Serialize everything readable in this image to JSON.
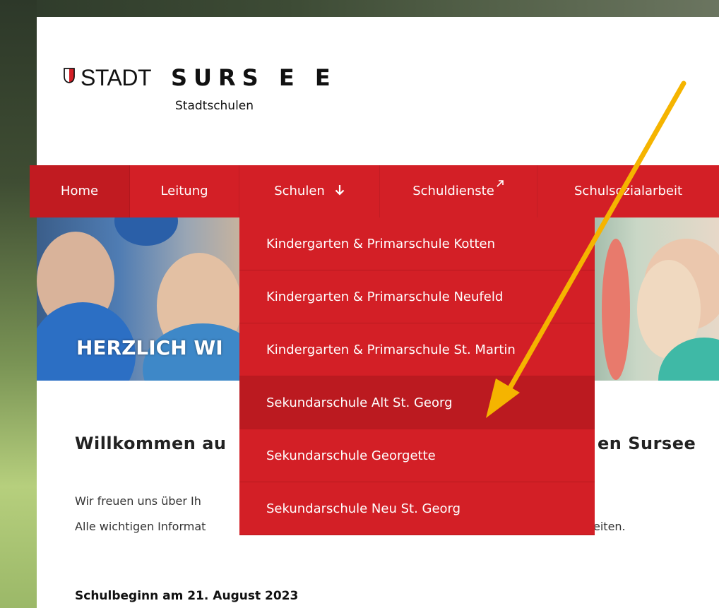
{
  "logo": {
    "stadt": "STADT",
    "sursee": "SURS E E",
    "subtitle": "Stadtschulen",
    "shield_color": "#d31f26"
  },
  "nav": {
    "items": [
      {
        "label": "Home",
        "active": true
      },
      {
        "label": "Leitung"
      },
      {
        "label": "Schulen",
        "icon": "arrow-down-icon",
        "open": true
      },
      {
        "label": "Schuldienste",
        "icon": "external-link-icon"
      },
      {
        "label": "Schulsozialarbeit"
      }
    ],
    "color": "#d31f26"
  },
  "hero": {
    "title": "HERZLICH WI"
  },
  "dropdown": {
    "items": [
      "Kindergarten & Primarschule Kotten",
      "Kindergarten & Primarschule Neufeld",
      "Kindergarten & Primarschule St. Martin",
      "Sekundarschule Alt St. Georg",
      "Sekundarschule Georgette",
      "Sekundarschule Neu St. Georg"
    ],
    "highlighted_index": 3
  },
  "content": {
    "welcome_start": "Willkommen au",
    "welcome_end": "en Sursee",
    "paragraph1": "Wir freuen uns über Ih",
    "paragraph2_start": "Alle wichtigen Informat",
    "paragraph2_end": "eiten.",
    "schulbeginn": "Schulbeginn am 21. August 2023"
  },
  "annotation": {
    "arrow_color": "#f5b400"
  }
}
